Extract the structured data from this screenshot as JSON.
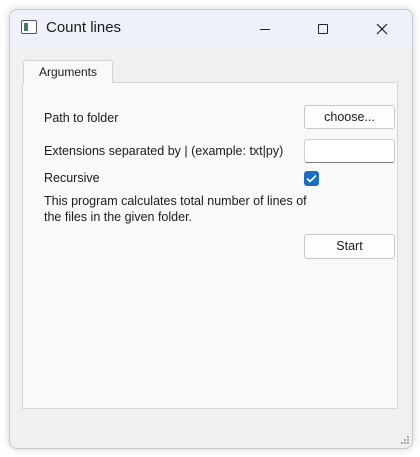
{
  "window": {
    "title": "Count lines",
    "controls": {
      "minimize": "minimize",
      "maximize": "maximize",
      "close": "close"
    }
  },
  "tabs": [
    {
      "label": "Arguments",
      "selected": true
    }
  ],
  "form": {
    "path_label": "Path to folder",
    "choose_button": "choose...",
    "extensions_label": "Extensions separated by | (example: txt|py)",
    "extensions_value": "",
    "recursive_label": "Recursive",
    "recursive_checked": true,
    "description_line1": "This program calculates total number of lines of",
    "description_line2": "the files in the given folder.",
    "start_button": "Start"
  },
  "colors": {
    "accent": "#1b6ec2",
    "title_bar": "#eef1f9",
    "window_bg": "#f0f0f0"
  },
  "icons": [
    "app-window-icon",
    "minimize-icon",
    "maximize-icon",
    "close-icon",
    "checkmark-icon",
    "resize-grip-icon"
  ]
}
